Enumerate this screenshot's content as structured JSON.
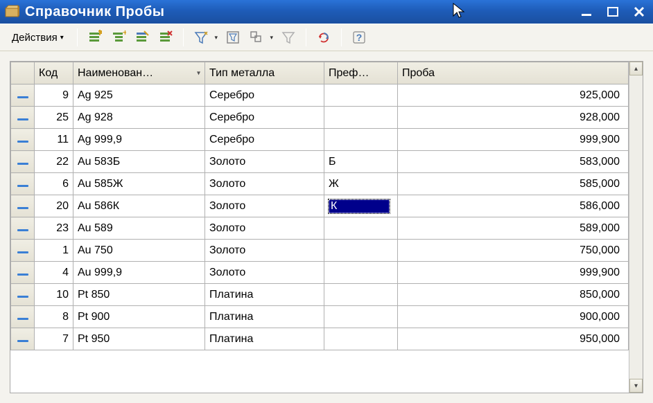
{
  "window": {
    "title": "Справочник Пробы"
  },
  "toolbar": {
    "actions_label": "Действия"
  },
  "grid": {
    "columns": {
      "code": "Код",
      "name": "Наименован…",
      "metal": "Тип металла",
      "prefix": "Преф…",
      "proba": "Проба"
    },
    "rows": [
      {
        "code": "9",
        "name": "Ag 925",
        "metal": "Серебро",
        "prefix": "",
        "proba": "925,000",
        "selected": false
      },
      {
        "code": "25",
        "name": "Ag 928",
        "metal": "Серебро",
        "prefix": "",
        "proba": "928,000",
        "selected": false
      },
      {
        "code": "11",
        "name": "Ag 999,9",
        "metal": "Серебро",
        "prefix": "",
        "proba": "999,900",
        "selected": false
      },
      {
        "code": "22",
        "name": "Au 583Б",
        "metal": "Золото",
        "prefix": "Б",
        "proba": "583,000",
        "selected": false
      },
      {
        "code": "6",
        "name": "Au 585Ж",
        "metal": "Золото",
        "prefix": "Ж",
        "proba": "585,000",
        "selected": false
      },
      {
        "code": "20",
        "name": "Au 586К",
        "metal": "Золото",
        "prefix": "К",
        "proba": "586,000",
        "selected": true
      },
      {
        "code": "23",
        "name": "Au 589",
        "metal": "Золото",
        "prefix": "",
        "proba": "589,000",
        "selected": false
      },
      {
        "code": "1",
        "name": "Au 750",
        "metal": "Золото",
        "prefix": "",
        "proba": "750,000",
        "selected": false
      },
      {
        "code": "4",
        "name": "Au 999,9",
        "metal": "Золото",
        "prefix": "",
        "proba": "999,900",
        "selected": false
      },
      {
        "code": "10",
        "name": "Pt 850",
        "metal": "Платина",
        "prefix": "",
        "proba": "850,000",
        "selected": false
      },
      {
        "code": "8",
        "name": "Pt 900",
        "metal": "Платина",
        "prefix": "",
        "proba": "900,000",
        "selected": false
      },
      {
        "code": "7",
        "name": "Pt 950",
        "metal": "Платина",
        "prefix": "",
        "proba": "950,000",
        "selected": false
      }
    ]
  }
}
